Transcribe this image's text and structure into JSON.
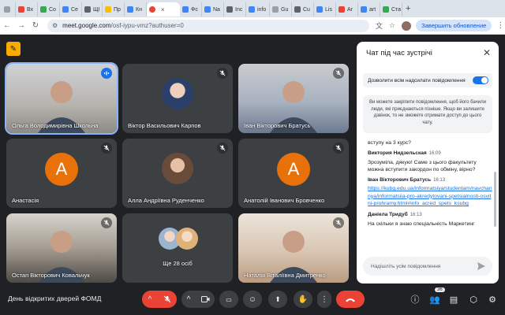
{
  "browser": {
    "tabs": [
      {
        "label": "",
        "color": "#9aa0a6"
      },
      {
        "label": "Вх",
        "color": "#ea4335"
      },
      {
        "label": "Со",
        "color": "#34a853"
      },
      {
        "label": "Се",
        "color": "#4285f4"
      },
      {
        "label": "ЩІ",
        "color": "#5f6368"
      },
      {
        "label": "Пр",
        "color": "#fbbc04"
      },
      {
        "label": "Кн",
        "color": "#4285f4"
      },
      {
        "label": "",
        "color": "#ea4335",
        "active": true
      },
      {
        "label": "Фс",
        "color": "#4285f4"
      },
      {
        "label": "Na",
        "color": "#4285f4"
      },
      {
        "label": "Inc",
        "color": "#5f6368"
      },
      {
        "label": "info",
        "color": "#4285f4"
      },
      {
        "label": "Gu",
        "color": "#9aa0a6"
      },
      {
        "label": "Cu",
        "color": "#5f6368"
      },
      {
        "label": "Lis",
        "color": "#4285f4"
      },
      {
        "label": "Ar",
        "color": "#ea4335"
      },
      {
        "label": "art",
        "color": "#4285f4"
      },
      {
        "label": "Ста",
        "color": "#34a853"
      }
    ],
    "url_host": "meet.google.com",
    "url_path": "/osf-iypu-vmz?authuser=0",
    "update_label": "Завершить обновление"
  },
  "participants": [
    {
      "name": "Ольга Володимирівна Школьна",
      "kind": "video",
      "speaking": true
    },
    {
      "name": "Віктор Васильович Карпов",
      "kind": "photo"
    },
    {
      "name": "Іван Вікторович Братусь",
      "kind": "video"
    },
    {
      "name": "Анастасія",
      "kind": "letter",
      "letter": "А"
    },
    {
      "name": "Алла Андріївна Руденченко",
      "kind": "photo"
    },
    {
      "name": "Анатолій Іванович Бровченко",
      "kind": "letter",
      "letter": "А"
    },
    {
      "name": "Остап Вікторович Ковальчук",
      "kind": "video"
    },
    {
      "name": "Ще 28 осіб",
      "kind": "group"
    },
    {
      "name": "Наталія Віталіївна Дмитренко",
      "kind": "video"
    }
  ],
  "meeting": {
    "title": "День відкритих дверей ФОМД",
    "people_count": "36"
  },
  "chat": {
    "title": "Чат під час зустрічі",
    "allow_label": "Дозволити всім надсилати повідомлення",
    "pin_notice": "Ви можете закріпити повідомлення, щоб його бачили люди, які приєднаються пізніше. Якщо ви залишите дзвінок, то не зможете отримати доступ до цього чату.",
    "messages": [
      {
        "author": "",
        "time": "",
        "text": "вступу на 3 курс?"
      },
      {
        "author": "Виктория Нидзельская",
        "time": "16:09",
        "text": "Зрозуміла, дякую! Саме з цього факультету можна вступити закордон по обміну, вірно?"
      },
      {
        "author": "Іван Вікторович Братусь",
        "time": "16:13",
        "link": "https://kubg.edu.ua/informatsiya/studentam/navchannya/informatsiia-pro-akredytovani-spetsialnosti-osvitni-prohramy.html#info_acred_spets_ksubg"
      },
      {
        "author": "Даніела Тридуб",
        "time": "16:13",
        "text": "На скільки я знаю спеціальність Маркетинг"
      }
    ],
    "input_placeholder": "Надішліть усім повідомлення"
  },
  "colors": {
    "accent": "#1a73e8",
    "end_call": "#ea4335",
    "avatar_orange": "#e8710a",
    "meet_bg": "#202124"
  }
}
